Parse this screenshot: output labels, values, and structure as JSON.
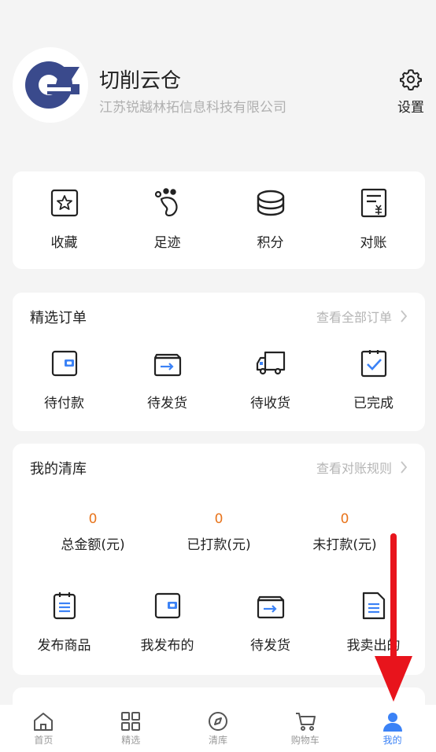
{
  "profile": {
    "name": "切削云仓",
    "company": "江苏锐越林拓信息科技有限公司",
    "settings_label": "设置"
  },
  "quick_actions": [
    {
      "label": "收藏",
      "icon": "star-icon"
    },
    {
      "label": "足迹",
      "icon": "footprint-icon"
    },
    {
      "label": "积分",
      "icon": "coins-icon"
    },
    {
      "label": "对账",
      "icon": "bill-icon"
    }
  ],
  "orders": {
    "title": "精选订单",
    "link": "查看全部订单",
    "items": [
      {
        "label": "待付款",
        "icon": "wallet-icon"
      },
      {
        "label": "待发货",
        "icon": "shipping-box-icon"
      },
      {
        "label": "待收货",
        "icon": "truck-icon"
      },
      {
        "label": "已完成",
        "icon": "check-clipboard-icon"
      }
    ]
  },
  "clearance": {
    "title": "我的清库",
    "link": "查看对账规则",
    "stats": [
      {
        "value": "0",
        "label": "总金额(元)"
      },
      {
        "value": "0",
        "label": "已打款(元)"
      },
      {
        "value": "0",
        "label": "未打款(元)"
      }
    ],
    "items": [
      {
        "label": "发布商品",
        "icon": "notepad-icon"
      },
      {
        "label": "我发布的",
        "icon": "wallet-icon"
      },
      {
        "label": "待发货",
        "icon": "shipping-box-icon"
      },
      {
        "label": "我卖出的",
        "icon": "document-icon"
      }
    ]
  },
  "tabbar": [
    {
      "label": "首页",
      "icon": "home-icon"
    },
    {
      "label": "精选",
      "icon": "grid-icon"
    },
    {
      "label": "清库",
      "icon": "compass-icon"
    },
    {
      "label": "购物车",
      "icon": "cart-icon"
    },
    {
      "label": "我的",
      "icon": "user-icon",
      "active": true
    }
  ],
  "colors": {
    "accent": "#3b82f6",
    "stat_value": "#e8741c",
    "arrow": "#e8141c",
    "logo": "#3a4a8c"
  }
}
